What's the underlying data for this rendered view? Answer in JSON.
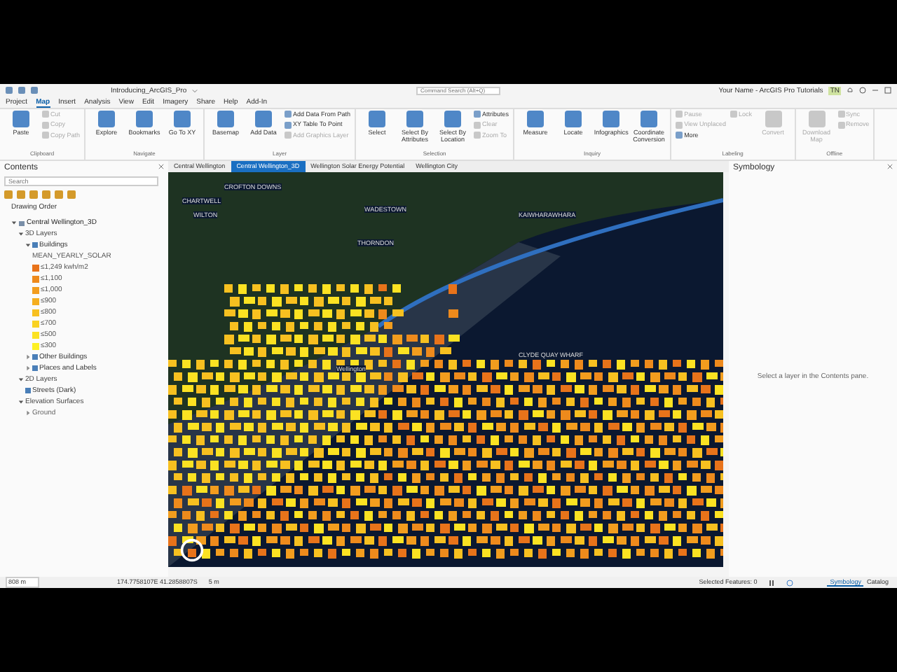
{
  "title_bar": {
    "title": "Introducing_ArcGIS_Pro",
    "command_search": {
      "placeholder": "Command Search (Alt+Q)"
    },
    "user": "Your Name - ArcGIS Pro Tutorials",
    "initials": "TN"
  },
  "menu_tabs": [
    {
      "label": "Project",
      "selected": false
    },
    {
      "label": "Map",
      "selected": true
    },
    {
      "label": "Insert",
      "selected": false
    },
    {
      "label": "Analysis",
      "selected": false
    },
    {
      "label": "View",
      "selected": false
    },
    {
      "label": "Edit",
      "selected": false
    },
    {
      "label": "Imagery",
      "selected": false
    },
    {
      "label": "Share",
      "selected": false
    },
    {
      "label": "Help",
      "selected": false
    },
    {
      "label": "Add-In",
      "selected": false
    }
  ],
  "ribbon_groups": [
    {
      "name": "Clipboard",
      "buttons": [
        {
          "label": "Paste",
          "kind": "large",
          "disabled": false
        },
        {
          "label": "Cut",
          "kind": "small",
          "disabled": true
        },
        {
          "label": "Copy",
          "kind": "small",
          "disabled": true
        },
        {
          "label": "Copy Path",
          "kind": "small",
          "disabled": true
        }
      ]
    },
    {
      "name": "Navigate",
      "buttons": [
        {
          "label": "Explore",
          "kind": "large",
          "disabled": false
        },
        {
          "label": "Bookmarks",
          "kind": "large",
          "disabled": false
        },
        {
          "label": "Go To XY",
          "kind": "large",
          "disabled": false
        }
      ]
    },
    {
      "name": "Layer",
      "buttons": [
        {
          "label": "Basemap",
          "kind": "large",
          "disabled": false
        },
        {
          "label": "Add Data",
          "kind": "large",
          "disabled": false
        },
        {
          "label": "Add Data From Path",
          "kind": "small",
          "disabled": false
        },
        {
          "label": "XY Table To Point",
          "kind": "small",
          "disabled": false
        },
        {
          "label": "Add Graphics Layer",
          "kind": "small",
          "disabled": true
        }
      ]
    },
    {
      "name": "Selection",
      "buttons": [
        {
          "label": "Select",
          "kind": "large",
          "disabled": false
        },
        {
          "label": "Select By Attributes",
          "kind": "large",
          "disabled": false
        },
        {
          "label": "Select By Location",
          "kind": "large",
          "disabled": false
        },
        {
          "label": "Attributes",
          "kind": "small",
          "disabled": false
        },
        {
          "label": "Clear",
          "kind": "small",
          "disabled": true
        },
        {
          "label": "Zoom To",
          "kind": "small",
          "disabled": true
        }
      ]
    },
    {
      "name": "Inquiry",
      "buttons": [
        {
          "label": "Measure",
          "kind": "large",
          "disabled": false
        },
        {
          "label": "Locate",
          "kind": "large",
          "disabled": false
        },
        {
          "label": "Infographics",
          "kind": "large",
          "disabled": false
        },
        {
          "label": "Coordinate Conversion",
          "kind": "large",
          "disabled": false
        }
      ]
    },
    {
      "name": "Labeling",
      "buttons": [
        {
          "label": "Pause",
          "kind": "small",
          "disabled": true
        },
        {
          "label": "View Unplaced",
          "kind": "small",
          "disabled": true
        },
        {
          "label": "More",
          "kind": "small",
          "disabled": false
        },
        {
          "label": "Lock",
          "kind": "small",
          "disabled": true
        },
        {
          "label": "Convert",
          "kind": "large",
          "disabled": true
        }
      ]
    },
    {
      "name": "Offline",
      "buttons": [
        {
          "label": "Download Map",
          "kind": "large",
          "disabled": true
        },
        {
          "label": "Sync",
          "kind": "small",
          "disabled": true
        },
        {
          "label": "Remove",
          "kind": "small",
          "disabled": true
        }
      ]
    }
  ],
  "contents": {
    "title": "Contents",
    "search": {
      "placeholder": "Search"
    },
    "heading": "Drawing Order",
    "tree": [
      {
        "kind": "map",
        "label": "Central Wellington_3D",
        "expanded": true,
        "children": [
          {
            "kind": "group",
            "label": "3D Layers",
            "expanded": true,
            "children": [
              {
                "kind": "layer",
                "label": "Buildings",
                "expanded": true,
                "checked": true,
                "children": [
                  {
                    "kind": "field",
                    "label": "MEAN_YEARLY_SOLAR"
                  },
                  {
                    "kind": "class",
                    "label": "≤1,249 kwh/m2",
                    "color": "#e8731a"
                  },
                  {
                    "kind": "class",
                    "label": "≤1,100",
                    "color": "#ee8a1c"
                  },
                  {
                    "kind": "class",
                    "label": "≤1,000",
                    "color": "#f29d1e"
                  },
                  {
                    "kind": "class",
                    "label": "≤900",
                    "color": "#f5ae1f"
                  },
                  {
                    "kind": "class",
                    "label": "≤800",
                    "color": "#f7c020"
                  },
                  {
                    "kind": "class",
                    "label": "≤700",
                    "color": "#f9d221"
                  },
                  {
                    "kind": "class",
                    "label": "≤500",
                    "color": "#fbe222"
                  },
                  {
                    "kind": "class",
                    "label": "≤300",
                    "color": "#fdf023"
                  }
                ]
              },
              {
                "kind": "layer",
                "label": "Other Buildings",
                "expanded": false,
                "checked": true
              },
              {
                "kind": "layer",
                "label": "Places and Labels",
                "expanded": false,
                "checked": true
              }
            ]
          },
          {
            "kind": "group",
            "label": "2D Layers",
            "expanded": true,
            "children": [
              {
                "kind": "layer",
                "label": "Streets (Dark)",
                "checked": true
              }
            ]
          },
          {
            "kind": "group",
            "label": "Elevation Surfaces",
            "expanded": true,
            "children": [
              {
                "kind": "surface",
                "label": "Ground",
                "expanded": false
              }
            ]
          }
        ]
      }
    ]
  },
  "map_tabs": [
    {
      "label": "Central Wellington",
      "selected": false
    },
    {
      "label": "Central Wellington_3D",
      "selected": true
    },
    {
      "label": "Wellington Solar Energy Potential",
      "selected": false
    },
    {
      "label": "Wellington City",
      "selected": false
    }
  ],
  "map_labels": [
    "CROFTON DOWNS",
    "CHARTWELL",
    "WILTON",
    "WADESTOWN",
    "KAIWHARAWHARA",
    "THORNDON",
    "Wellington",
    "CLYDE QUAY WHARF"
  ],
  "symbology": {
    "title": "Symbology",
    "message": "Select a layer in the Contents pane."
  },
  "status_bar": {
    "scale": "808 m",
    "coordinates": "174.7758107E 41.2858807S",
    "elevation": "5 m",
    "selected_features": "Selected Features: 0"
  },
  "pane_tabs": [
    {
      "label": "Symbology",
      "selected": true
    },
    {
      "label": "Catalog",
      "selected": false
    }
  ]
}
